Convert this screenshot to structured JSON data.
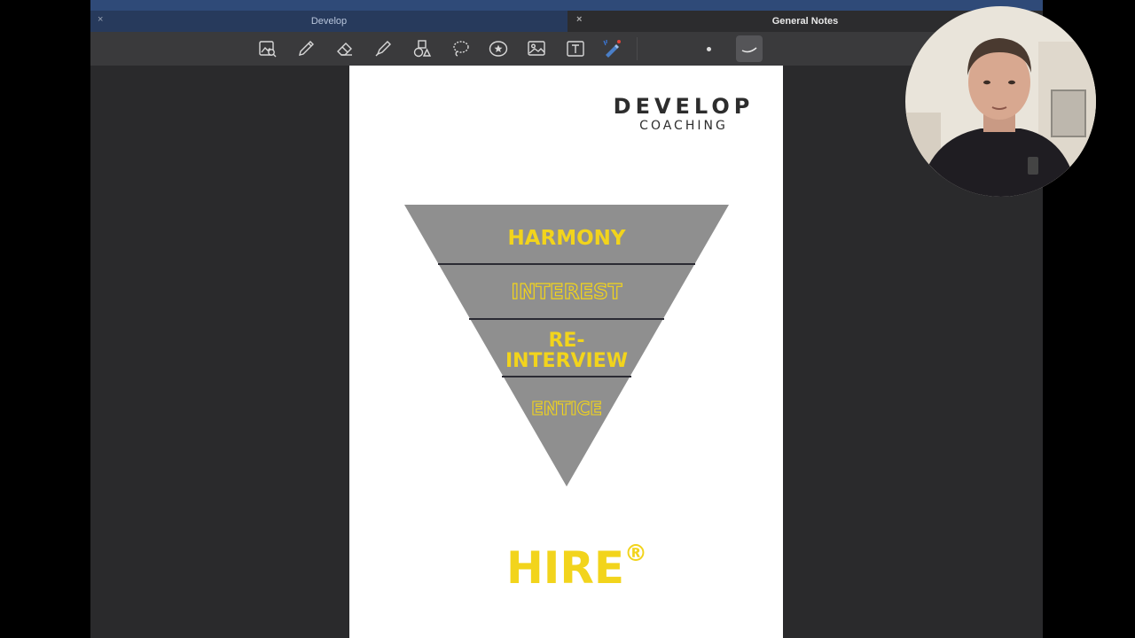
{
  "tabs": [
    {
      "label": "Develop",
      "close": "×"
    },
    {
      "label": "General Notes",
      "close": "×"
    }
  ],
  "toolbar": {
    "tools": [
      "image-search-icon",
      "pen-icon",
      "eraser-icon",
      "highlighter-icon",
      "shapes-icon",
      "lasso-icon",
      "sticker-icon",
      "image-icon",
      "text-icon",
      "laser-pointer-icon"
    ]
  },
  "document": {
    "logo": {
      "main": "DEVELOP",
      "sub": "COACHING"
    },
    "funnel_levels": [
      {
        "label": "HARMONY",
        "style": "filled"
      },
      {
        "label": "INTEREST",
        "style": "outlined"
      },
      {
        "label": "RE-",
        "label2": "INTERVIEW",
        "style": "filled"
      },
      {
        "label": "ENTICE",
        "style": "outlined"
      }
    ],
    "title": "HIRE",
    "title_mark": "®"
  },
  "colors": {
    "accent_yellow": "#f2d41c",
    "funnel_gray": "#8f8f8f",
    "app_background": "#2a2a2c",
    "active_tab": "#273a5c"
  }
}
